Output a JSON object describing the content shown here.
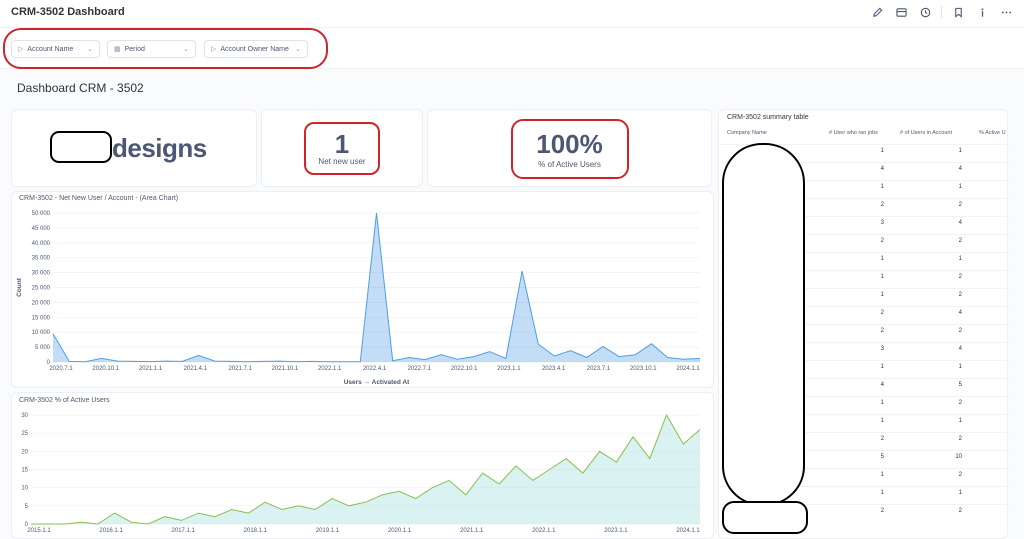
{
  "app": {
    "title": "CRM-3502 Dashboard"
  },
  "toolbar": {
    "icons": [
      "pencil-icon",
      "card-icon",
      "clock-icon",
      "bookmark-icon",
      "info-icon",
      "more-icon"
    ]
  },
  "filters": [
    {
      "label": "Account Name",
      "icon": "tag-icon"
    },
    {
      "label": "Period",
      "icon": "calendar-icon"
    },
    {
      "label": "Account Owner Name",
      "icon": "tag-icon"
    }
  ],
  "dashboard": {
    "heading": "Dashboard CRM - 3502"
  },
  "logo_card": {
    "text": "designs"
  },
  "scalar_new_users": {
    "value": "1",
    "label": "Net new user"
  },
  "scalar_active": {
    "value": "100%",
    "label": "% of Active Users"
  },
  "area_chart": {
    "title": "CRM-3502 - Net New User / Account - (Area Chart)",
    "chart_data": {
      "type": "area",
      "title": "CRM-3502 - Net New User / Account - (Area Chart)",
      "xlabel": "Users → Activated At",
      "ylabel": "Count",
      "ylim": [
        0,
        50000
      ],
      "yticks": [
        "0",
        "5 000",
        "10 000",
        "15 000",
        "20 000",
        "25 000",
        "30 000",
        "35 000",
        "40 000",
        "45 000",
        "50 000"
      ],
      "xticks": [
        "2020.7.1",
        "2020.10.1",
        "2021.1.1",
        "2021.4.1",
        "2021.7.1",
        "2021.10.1",
        "2022.1.1",
        "2022.4.1",
        "2022.7.1",
        "2022.10.1",
        "2023.1.1",
        "2023.4.1",
        "2023.7.1",
        "2023.10.1",
        "2024.1.1"
      ],
      "series": [
        {
          "values": [
            9500,
            200,
            100,
            1200,
            300,
            200,
            150,
            300,
            200,
            2200,
            300,
            200,
            100,
            200,
            300,
            100,
            200,
            100,
            100,
            100,
            50000,
            400,
            1500,
            800,
            2500,
            900,
            1800,
            3500,
            1200,
            30500,
            6000,
            2000,
            3800,
            1500,
            5200,
            1800,
            2400,
            6100,
            1500,
            900,
            1200
          ]
        }
      ]
    }
  },
  "active_chart": {
    "title": "CRM-3502 % of Active Users",
    "chart_data": {
      "type": "area",
      "title": "CRM-3502 % of Active Users",
      "ylim": [
        0,
        30
      ],
      "yticks": [
        "0",
        "5",
        "10",
        "15",
        "20",
        "25",
        "30"
      ],
      "xticks": [
        "2015.1.1",
        "2016.1.1",
        "2017.1.1",
        "2018.1.1",
        "2019.1.1",
        "2020.1.1",
        "2021.1.1",
        "2022.1.1",
        "2023.1.1",
        "2024.1.1"
      ],
      "series": [
        {
          "values": [
            0,
            0,
            0,
            0.5,
            0,
            3,
            0.5,
            0,
            2,
            1,
            3,
            2,
            4,
            3,
            6,
            4,
            5,
            4,
            7,
            5,
            6,
            8,
            9,
            7,
            10,
            12,
            8,
            14,
            11,
            16,
            12,
            15,
            18,
            14,
            20,
            17,
            24,
            18,
            30,
            22,
            26
          ]
        }
      ]
    }
  },
  "table": {
    "title": "CRM-3502 summary table",
    "columns": [
      "Company Name",
      "# User who ran jobs",
      "# of Users in Account",
      "% Active U"
    ],
    "rows": [
      [
        "1",
        "1"
      ],
      [
        "4",
        "4"
      ],
      [
        "1",
        "1"
      ],
      [
        "2",
        "2"
      ],
      [
        "3",
        "4"
      ],
      [
        "2",
        "2"
      ],
      [
        "1",
        "1"
      ],
      [
        "1",
        "2"
      ],
      [
        "1",
        "2"
      ],
      [
        "2",
        "4"
      ],
      [
        "2",
        "2"
      ],
      [
        "3",
        "4"
      ],
      [
        "1",
        "1"
      ],
      [
        "4",
        "5"
      ],
      [
        "1",
        "2"
      ],
      [
        "1",
        "1"
      ],
      [
        "2",
        "2"
      ],
      [
        "5",
        "10"
      ],
      [
        "1",
        "2"
      ],
      [
        "1",
        "1"
      ],
      [
        "2",
        "2"
      ]
    ]
  }
}
